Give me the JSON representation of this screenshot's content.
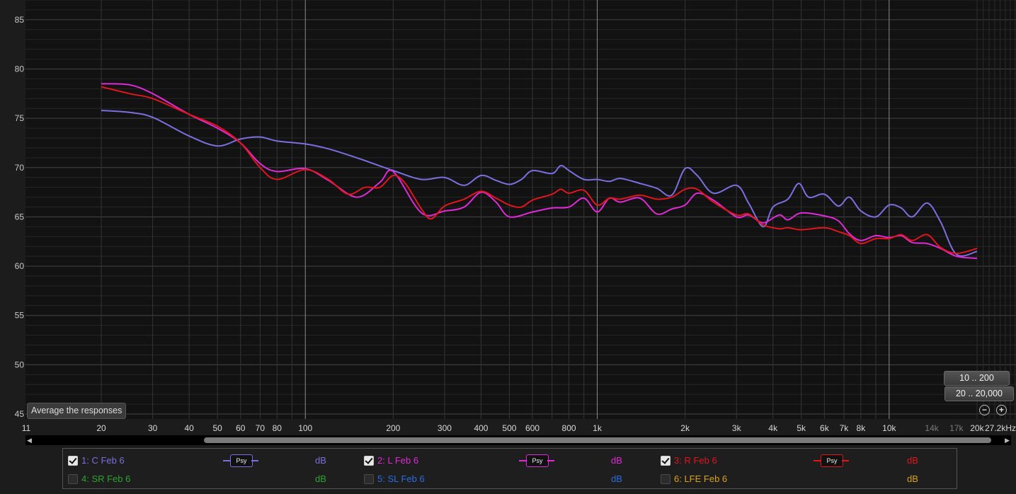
{
  "chart_data": {
    "type": "line",
    "x_scale": "log",
    "xlim": [
      11,
      27200
    ],
    "ylim": [
      44.5,
      87
    ],
    "grid": true,
    "y_ticks": [
      45,
      50,
      55,
      60,
      65,
      70,
      75,
      80,
      85
    ],
    "x_ticks": [
      {
        "v": 11,
        "label": "11"
      },
      {
        "v": 20,
        "label": "20"
      },
      {
        "v": 30,
        "label": "30"
      },
      {
        "v": 40,
        "label": "40"
      },
      {
        "v": 50,
        "label": "50"
      },
      {
        "v": 60,
        "label": "60"
      },
      {
        "v": 70,
        "label": "70"
      },
      {
        "v": 80,
        "label": "80"
      },
      {
        "v": 100,
        "label": "100"
      },
      {
        "v": 200,
        "label": "200"
      },
      {
        "v": 300,
        "label": "300"
      },
      {
        "v": 400,
        "label": "400"
      },
      {
        "v": 500,
        "label": "500"
      },
      {
        "v": 600,
        "label": "600"
      },
      {
        "v": 800,
        "label": "800"
      },
      {
        "v": 1000,
        "label": "1k"
      },
      {
        "v": 2000,
        "label": "2k"
      },
      {
        "v": 3000,
        "label": "3k"
      },
      {
        "v": 4000,
        "label": "4k"
      },
      {
        "v": 5000,
        "label": "5k"
      },
      {
        "v": 6000,
        "label": "6k"
      },
      {
        "v": 7000,
        "label": "7k"
      },
      {
        "v": 8000,
        "label": "8k"
      },
      {
        "v": 10000,
        "label": "10k"
      },
      {
        "v": 14000,
        "label": "14k",
        "dim": true
      },
      {
        "v": 17000,
        "label": "17k",
        "dim": true
      },
      {
        "v": 20000,
        "label": "20k"
      },
      {
        "v": 27200,
        "label": "27.2kHz"
      }
    ],
    "series": [
      {
        "name": "1: C Feb 6",
        "color": "#7b6fe0",
        "points": [
          [
            20,
            75.8
          ],
          [
            25,
            75.6
          ],
          [
            30,
            75.1
          ],
          [
            40,
            73.2
          ],
          [
            50,
            72.2
          ],
          [
            60,
            72.9
          ],
          [
            70,
            73.1
          ],
          [
            80,
            72.7
          ],
          [
            100,
            72.4
          ],
          [
            120,
            71.9
          ],
          [
            150,
            71.0
          ],
          [
            200,
            69.7
          ],
          [
            250,
            68.8
          ],
          [
            300,
            69.0
          ],
          [
            350,
            68.2
          ],
          [
            400,
            69.2
          ],
          [
            450,
            68.7
          ],
          [
            500,
            68.3
          ],
          [
            550,
            68.8
          ],
          [
            600,
            69.7
          ],
          [
            700,
            69.4
          ],
          [
            750,
            70.2
          ],
          [
            800,
            69.7
          ],
          [
            900,
            68.8
          ],
          [
            1000,
            68.8
          ],
          [
            1100,
            68.6
          ],
          [
            1200,
            68.9
          ],
          [
            1400,
            68.4
          ],
          [
            1600,
            67.9
          ],
          [
            1800,
            67.2
          ],
          [
            2000,
            69.9
          ],
          [
            2200,
            69.2
          ],
          [
            2500,
            67.4
          ],
          [
            3000,
            68.2
          ],
          [
            3300,
            66.4
          ],
          [
            3700,
            64.0
          ],
          [
            4000,
            66.0
          ],
          [
            4500,
            66.8
          ],
          [
            4900,
            68.4
          ],
          [
            5300,
            67.0
          ],
          [
            6000,
            67.3
          ],
          [
            6700,
            66.1
          ],
          [
            7300,
            67.0
          ],
          [
            8000,
            65.6
          ],
          [
            9000,
            65.0
          ],
          [
            10000,
            66.2
          ],
          [
            11000,
            65.9
          ],
          [
            12000,
            65.0
          ],
          [
            13500,
            66.4
          ],
          [
            15000,
            64.5
          ],
          [
            17000,
            61.2
          ],
          [
            20000,
            61.5
          ]
        ]
      },
      {
        "name": "2: L Feb 6",
        "color": "#e02ad8",
        "points": [
          [
            20,
            78.5
          ],
          [
            25,
            78.4
          ],
          [
            30,
            77.5
          ],
          [
            40,
            75.4
          ],
          [
            50,
            74.0
          ],
          [
            60,
            72.5
          ],
          [
            70,
            70.4
          ],
          [
            80,
            69.6
          ],
          [
            100,
            69.9
          ],
          [
            120,
            68.7
          ],
          [
            150,
            67.0
          ],
          [
            180,
            68.5
          ],
          [
            200,
            69.6
          ],
          [
            250,
            65.4
          ],
          [
            300,
            65.6
          ],
          [
            350,
            66.0
          ],
          [
            400,
            67.5
          ],
          [
            450,
            66.5
          ],
          [
            500,
            65.0
          ],
          [
            600,
            65.5
          ],
          [
            700,
            65.9
          ],
          [
            800,
            66.0
          ],
          [
            900,
            66.9
          ],
          [
            1000,
            65.5
          ],
          [
            1100,
            66.9
          ],
          [
            1200,
            66.5
          ],
          [
            1400,
            66.9
          ],
          [
            1600,
            65.3
          ],
          [
            1800,
            65.8
          ],
          [
            2000,
            66.2
          ],
          [
            2200,
            67.4
          ],
          [
            2500,
            66.7
          ],
          [
            3000,
            65.0
          ],
          [
            3300,
            65.2
          ],
          [
            3700,
            64.4
          ],
          [
            4200,
            65.2
          ],
          [
            4500,
            64.7
          ],
          [
            5000,
            65.4
          ],
          [
            6000,
            65.1
          ],
          [
            6700,
            64.6
          ],
          [
            7300,
            63.3
          ],
          [
            8000,
            62.6
          ],
          [
            9000,
            63.1
          ],
          [
            10000,
            62.9
          ],
          [
            11000,
            63.1
          ],
          [
            12000,
            62.4
          ],
          [
            13500,
            62.3
          ],
          [
            15000,
            61.8
          ],
          [
            17000,
            61.0
          ],
          [
            20000,
            60.8
          ]
        ]
      },
      {
        "name": "3: R Feb 6",
        "color": "#e0161c",
        "points": [
          [
            20,
            78.2
          ],
          [
            25,
            77.5
          ],
          [
            30,
            77.0
          ],
          [
            40,
            75.4
          ],
          [
            50,
            74.2
          ],
          [
            60,
            72.5
          ],
          [
            70,
            70.0
          ],
          [
            80,
            68.8
          ],
          [
            100,
            69.8
          ],
          [
            120,
            68.8
          ],
          [
            140,
            67.3
          ],
          [
            160,
            68.0
          ],
          [
            180,
            68.0
          ],
          [
            200,
            69.2
          ],
          [
            220,
            68.4
          ],
          [
            250,
            65.8
          ],
          [
            270,
            64.8
          ],
          [
            300,
            66.1
          ],
          [
            350,
            66.8
          ],
          [
            400,
            67.6
          ],
          [
            450,
            66.9
          ],
          [
            500,
            66.2
          ],
          [
            550,
            66.0
          ],
          [
            600,
            66.7
          ],
          [
            700,
            67.3
          ],
          [
            750,
            67.8
          ],
          [
            800,
            67.4
          ],
          [
            900,
            67.7
          ],
          [
            1000,
            66.2
          ],
          [
            1100,
            66.9
          ],
          [
            1200,
            66.8
          ],
          [
            1400,
            67.2
          ],
          [
            1600,
            66.8
          ],
          [
            1800,
            67.0
          ],
          [
            2000,
            67.8
          ],
          [
            2200,
            67.8
          ],
          [
            2500,
            66.5
          ],
          [
            3000,
            65.2
          ],
          [
            3300,
            65.3
          ],
          [
            3700,
            64.2
          ],
          [
            4200,
            63.8
          ],
          [
            4500,
            63.9
          ],
          [
            5000,
            63.7
          ],
          [
            6000,
            63.9
          ],
          [
            6700,
            63.5
          ],
          [
            7300,
            63.1
          ],
          [
            8000,
            62.3
          ],
          [
            9000,
            62.8
          ],
          [
            10000,
            62.8
          ],
          [
            11000,
            63.2
          ],
          [
            12000,
            62.6
          ],
          [
            13500,
            63.2
          ],
          [
            15000,
            61.9
          ],
          [
            17000,
            61.3
          ],
          [
            20000,
            61.8
          ]
        ]
      }
    ]
  },
  "controls": {
    "average_button": "Average the responses",
    "range_buttons": [
      "10 .. 200",
      "20 .. 20,000"
    ]
  },
  "legend": [
    {
      "label": "1: C Feb 6",
      "color": "#7b6fe0",
      "checked": true,
      "psy": "Psy",
      "unit": "dB",
      "unit_color": "#7b6fe0"
    },
    {
      "label": "2: L Feb 6",
      "color": "#e02ad8",
      "checked": true,
      "psy": "Psy",
      "unit": "dB",
      "unit_color": "#e02ad8"
    },
    {
      "label": "3: R Feb 6",
      "color": "#e0161c",
      "checked": true,
      "psy": "Psy",
      "unit": "dB",
      "unit_color": "#e0161c"
    },
    {
      "label": "4: SR Feb 6",
      "color": "#2ea32e",
      "checked": false,
      "unit": "dB",
      "unit_color": "#2ea32e"
    },
    {
      "label": "5: SL Feb 6",
      "color": "#2a6de0",
      "checked": false,
      "unit": "dB",
      "unit_color": "#2a6de0"
    },
    {
      "label": "6: LFE Feb 6",
      "color": "#d9a21a",
      "checked": false,
      "unit": "dB",
      "unit_color": "#d9a21a"
    }
  ]
}
